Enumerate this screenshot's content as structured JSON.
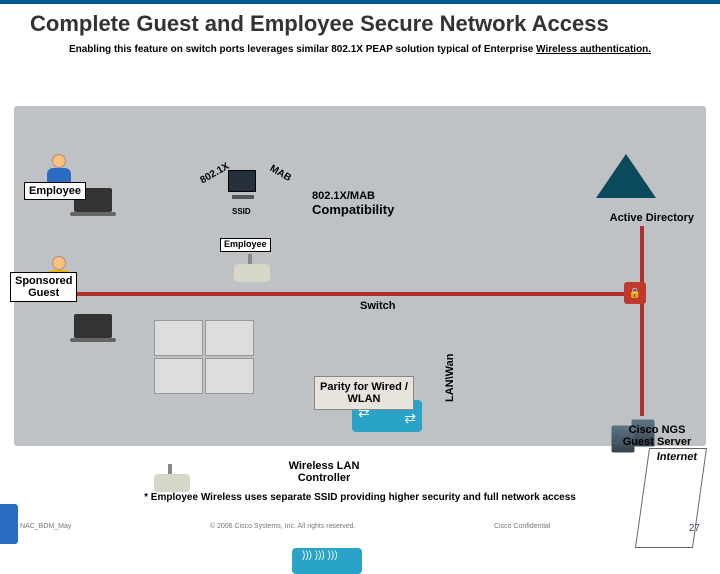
{
  "title": "Complete Guest and Employee Secure Network Access",
  "subtitle_pre": "Enabling this feature on switch ports leverages similar 802.1X PEAP solution typical of Enterprise ",
  "subtitle_ul": "Wireless authentication.",
  "labels": {
    "employee": "Employee",
    "sponsored_guest": "Sponsored\nGuest",
    "employee2": "Employee",
    "dot1x": "802.1X",
    "mab": "MAB",
    "ssid": "SSID",
    "compat_top": "802.1X/MAB",
    "compat_bot": "Compatibility",
    "ad": "Active Directory",
    "switch": "Switch",
    "lanwan": "LAN\\Wan",
    "parity": "Parity for Wired / WLAN",
    "wlc": "Wireless LAN Controller",
    "ngs": "Cisco NGS Guest Server",
    "internet": "Internet"
  },
  "footnote": "* Employee Wireless uses separate SSID providing higher security and full network access",
  "footer": {
    "left": "NAC_BDM_May",
    "mid": "© 2006 Cisco Systems, Inc. All rights reserved.",
    "conf": "Cisco Confidential",
    "page": "27"
  }
}
